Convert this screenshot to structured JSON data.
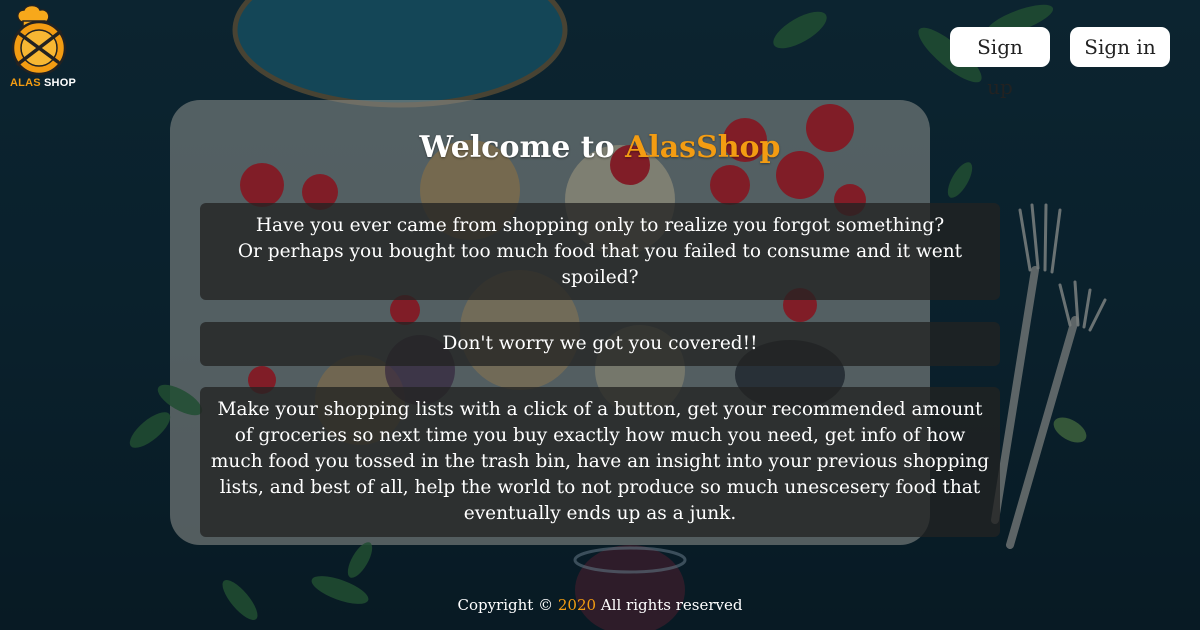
{
  "logo": {
    "icon": "chef-plate-utensils-icon",
    "text_part1": "ALAS",
    "text_part2": "SHOP"
  },
  "header": {
    "signup_label": "Sign up",
    "signin_label": "Sign in"
  },
  "hero": {
    "welcome_prefix": "Welcome to",
    "brand": "AlasShop"
  },
  "cards": {
    "intro_line1": "Have you ever came from shopping only to realize you forgot something?",
    "intro_line2": "Or perhaps you bought too much food that you failed to consume and it went spoiled?",
    "reassure": "Don't worry we got you covered!!",
    "features": "Make your shopping lists with a click of a button, get your recommended amount of groceries so next time you buy exactly how much you need, get info of how much food you tossed in the trash bin, have an insight into your previous shopping lists, and best of all, help the world to not produce so much unescesery food that eventually ends up as a junk."
  },
  "footer": {
    "prefix": "Copyright ©",
    "year": "2020",
    "suffix": "All rights reserved"
  },
  "colors": {
    "accent": "#f39c12",
    "background": "#0e2a38",
    "card_bg": "rgba(35,35,35,0.78)"
  }
}
